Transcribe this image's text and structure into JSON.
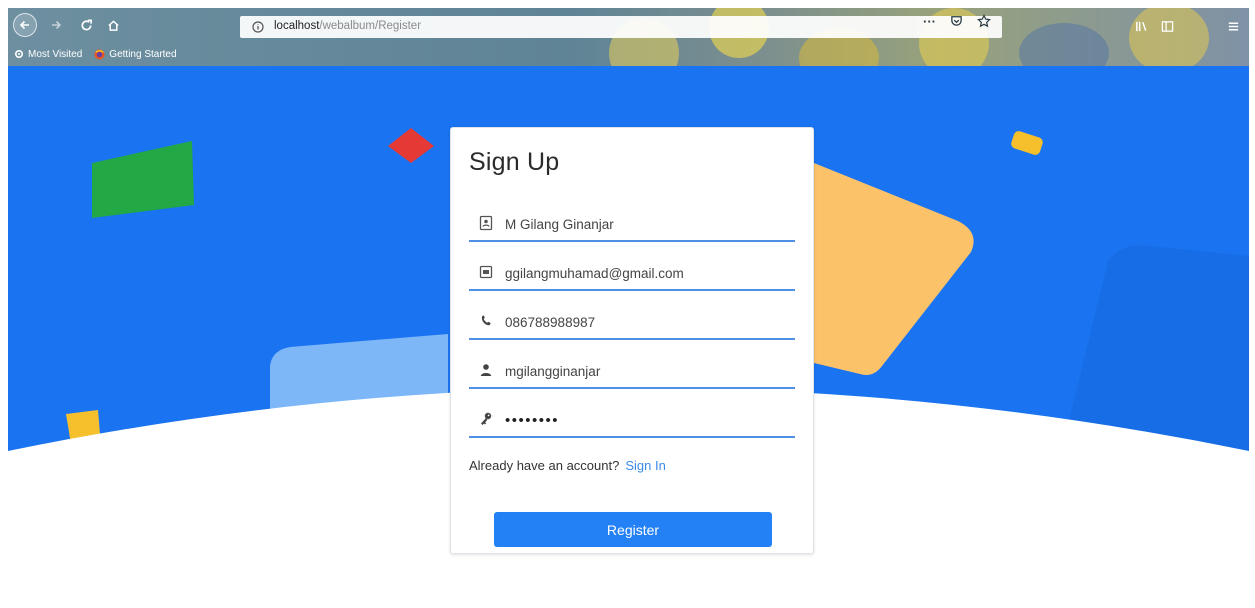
{
  "browser": {
    "url_host": "localhost",
    "url_path": "/webalbum/Register",
    "bookmarks": [
      {
        "label": "Most Visited",
        "icon": "gear-icon"
      },
      {
        "label": "Getting Started",
        "icon": "firefox-icon"
      }
    ],
    "page_actions_label": "···"
  },
  "form": {
    "title": "Sign Up",
    "fields": [
      {
        "name": "full-name",
        "value": "M Gilang Ginanjar",
        "icon": "id-card-icon"
      },
      {
        "name": "email",
        "value": "ggilangmuhamad@gmail.com",
        "icon": "envelope-icon"
      },
      {
        "name": "phone",
        "value": "086788988987",
        "icon": "phone-icon"
      },
      {
        "name": "username",
        "value": "mgilangginanjar",
        "icon": "user-icon"
      },
      {
        "name": "password",
        "value": "••••••••",
        "icon": "key-icon"
      }
    ],
    "signin_prompt": "Already have an account?",
    "signin_link": "Sign In",
    "submit_label": "Register"
  },
  "colors": {
    "hero_blue": "#1a73f0",
    "accent": "#2381f5",
    "field_underline": "#4f8fe6",
    "shape_green": "#22a845",
    "shape_red": "#e53935",
    "shape_orange": "#fbc26a",
    "shape_yellow": "#f6c02c",
    "shape_light": "#7eb7f7"
  }
}
